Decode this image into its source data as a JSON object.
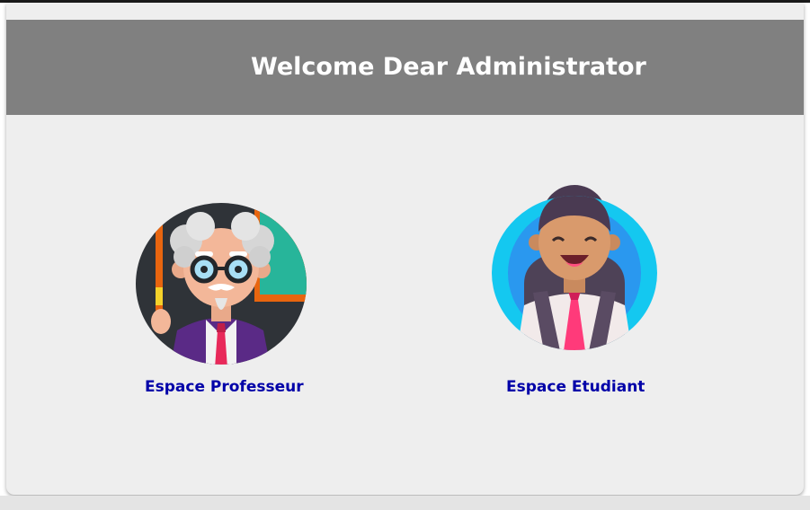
{
  "header": {
    "title": "Welcome Dear Administrator"
  },
  "spaces": [
    {
      "label": "Espace Professeur",
      "icon": "professor-avatar-icon"
    },
    {
      "label": "Espace Etudiant",
      "icon": "student-avatar-icon"
    }
  ],
  "colors": {
    "header_bg": "#808080",
    "page_bg": "#eeeeee",
    "link": "#0000a8"
  }
}
